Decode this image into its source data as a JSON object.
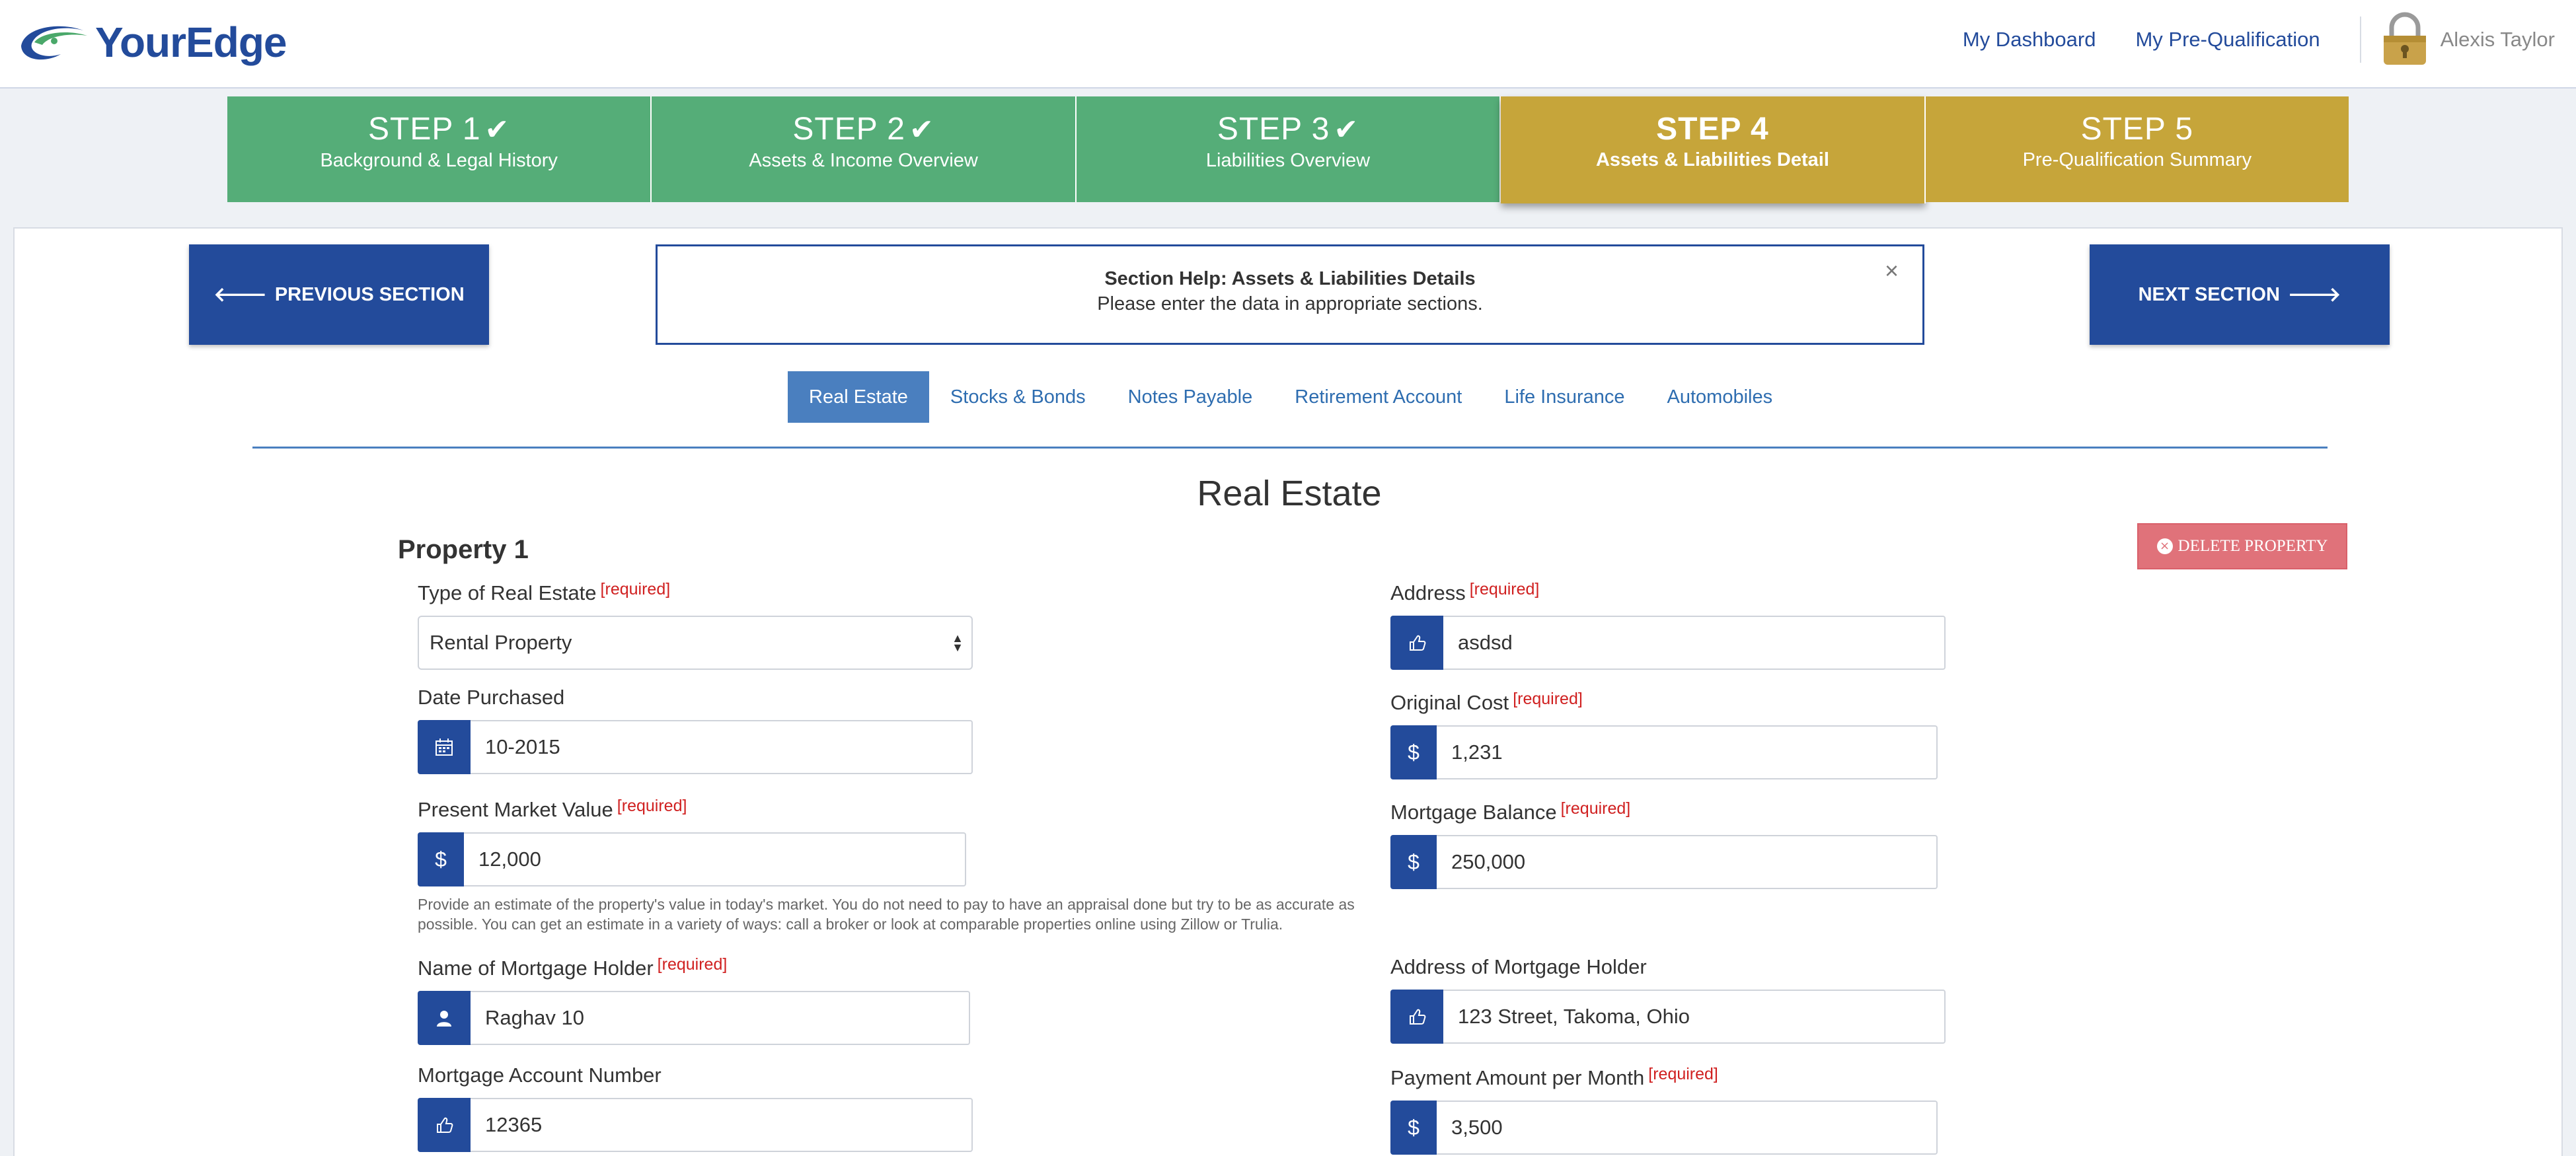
{
  "header": {
    "logo_text": "YourEdge",
    "nav": [
      "My Dashboard",
      "My Pre-Qualification"
    ],
    "user_name": "Alexis Taylor",
    "brand_color": "#234b9b"
  },
  "steps": [
    {
      "title": "STEP 1",
      "subtitle": "Background & Legal History",
      "status": "done"
    },
    {
      "title": "STEP 2",
      "subtitle": "Assets & Income Overview",
      "status": "done"
    },
    {
      "title": "STEP 3",
      "subtitle": "Liabilities Overview",
      "status": "done"
    },
    {
      "title": "STEP 4",
      "subtitle": "Assets & Liabilities Detail",
      "status": "active"
    },
    {
      "title": "STEP 5",
      "subtitle": "Pre-Qualification Summary",
      "status": "pending"
    }
  ],
  "buttons": {
    "previous": "PREVIOUS SECTION",
    "next": "NEXT SECTION",
    "delete_property": "DELETE PROPERTY"
  },
  "help": {
    "title": "Section Help: Assets & Liabilities Details",
    "text": "Please enter the data in appropriate sections.",
    "close": "×"
  },
  "tabs": [
    "Real Estate",
    "Stocks & Bonds",
    "Notes Payable",
    "Retirement Account",
    "Life Insurance",
    "Automobiles"
  ],
  "active_tab": "Real Estate",
  "section_title": "Real Estate",
  "property_title": "Property 1",
  "required_label": "[required]",
  "fields": {
    "type": {
      "label": "Type of Real Estate",
      "value": "Rental Property"
    },
    "date": {
      "label": "Date Purchased",
      "value": "10-2015"
    },
    "market": {
      "label": "Present Market Value",
      "value": "12,000",
      "hint": "Provide an estimate of the property's value in today's market. You do not need to pay to have an appraisal done but try to be as accurate as possible. You can get an estimate in a variety of ways: call a broker or look at comparable properties online using Zillow or Trulia."
    },
    "holder_name": {
      "label": "Name of Mortgage Holder",
      "value": "Raghav 10"
    },
    "account": {
      "label": "Mortgage Account Number",
      "value": "12365"
    },
    "address": {
      "label": "Address",
      "value": "asdsd"
    },
    "cost": {
      "label": "Original Cost",
      "value": "1,231"
    },
    "balance": {
      "label": "Mortgage Balance",
      "value": "250,000"
    },
    "holder_address": {
      "label": "Address of Mortgage Holder",
      "value": "123 Street, Takoma, Ohio"
    },
    "payment": {
      "label": "Payment Amount per Month",
      "value": "3,500"
    }
  },
  "currency_symbol": "$"
}
